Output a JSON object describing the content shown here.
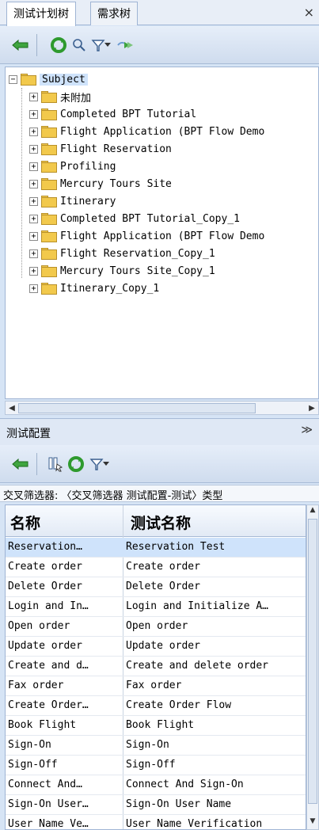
{
  "tabs": [
    {
      "label": "测试计划树",
      "active": true
    },
    {
      "label": "需求树",
      "active": false
    }
  ],
  "close_label": "×",
  "tree": {
    "root": "Subject",
    "items": [
      "未附加",
      "Completed BPT Tutorial",
      "Flight Application (BPT Flow Demo",
      "Flight Reservation",
      "Profiling",
      "Mercury Tours Site",
      "Itinerary",
      "Completed BPT Tutorial_Copy_1",
      "Flight Application (BPT Flow Demo",
      "Flight Reservation_Copy_1",
      "Mercury Tours Site_Copy_1",
      "Itinerary_Copy_1"
    ]
  },
  "config_section": {
    "title": "测试配置",
    "collapse_glyph": "≫",
    "filter_text": "交叉筛选器: 〈交叉筛选器 测试配置-测试〉类型"
  },
  "grid": {
    "headers": [
      "名称",
      "测试名称"
    ],
    "rows": [
      [
        "Reservation…",
        "Reservation Test"
      ],
      [
        "Create order",
        "Create order"
      ],
      [
        "Delete Order",
        "Delete Order"
      ],
      [
        "Login and In…",
        "Login and Initialize A…"
      ],
      [
        "Open order",
        "Open order"
      ],
      [
        "Update order",
        "Update order"
      ],
      [
        "Create and d…",
        "Create and delete order"
      ],
      [
        "Fax order",
        "Fax order"
      ],
      [
        "Create Order…",
        "Create Order Flow"
      ],
      [
        "Book Flight",
        "Book Flight"
      ],
      [
        "Sign-On",
        "Sign-On"
      ],
      [
        "Sign-Off",
        "Sign-Off"
      ],
      [
        "Connect And…",
        "Connect And Sign-On"
      ],
      [
        "Sign-On User…",
        "Sign-On User Name"
      ],
      [
        "User Name Ve…",
        "User Name Verification"
      ]
    ]
  },
  "colors": {
    "accent_green": "#2e9a2e",
    "selection": "#cfe3fb"
  }
}
